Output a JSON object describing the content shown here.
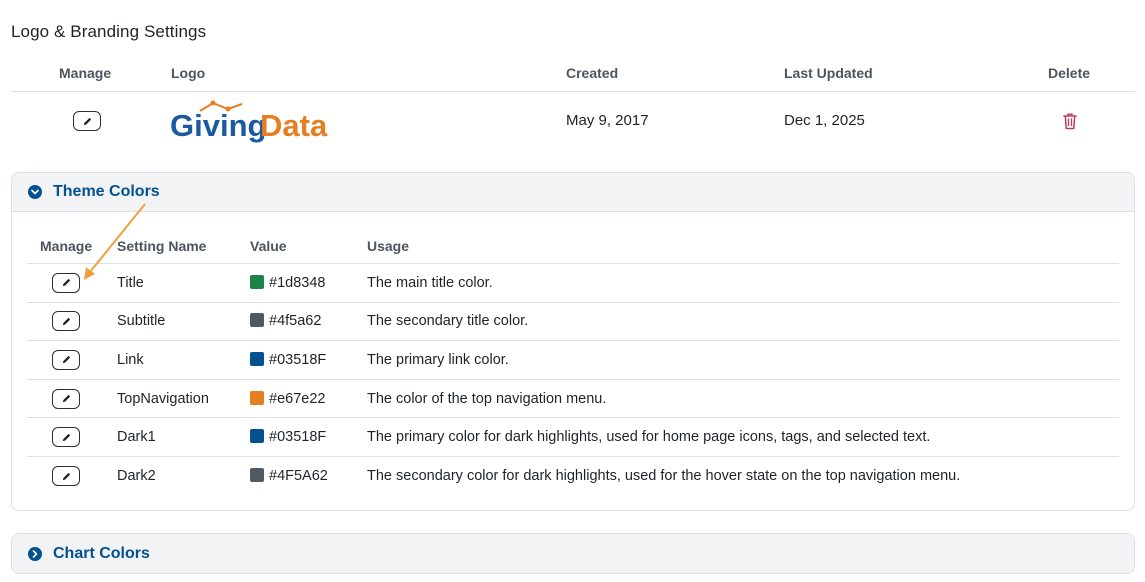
{
  "page": {
    "title": "Logo & Branding Settings"
  },
  "logo_table": {
    "headers": {
      "manage": "Manage",
      "logo": "Logo",
      "created": "Created",
      "updated": "Last Updated",
      "delete": "Delete"
    },
    "row": {
      "logo_text_part1": "Giving",
      "logo_text_part2": "Data",
      "created": "May 9, 2017",
      "updated": "Dec 1, 2025"
    }
  },
  "theme_colors": {
    "title": "Theme Colors",
    "headers": {
      "manage": "Manage",
      "name": "Setting Name",
      "value": "Value",
      "usage": "Usage"
    },
    "rows": [
      {
        "name": "Title",
        "value": "#1d8348",
        "usage": "The main title color."
      },
      {
        "name": "Subtitle",
        "value": "#4f5a62",
        "usage": "The secondary title color."
      },
      {
        "name": "Link",
        "value": "#03518F",
        "usage": "The primary link color."
      },
      {
        "name": "TopNavigation",
        "value": "#e67e22",
        "usage": "The color of the top navigation menu."
      },
      {
        "name": "Dark1",
        "value": "#03518F",
        "usage": "The primary color for dark highlights, used for home page icons, tags, and selected text."
      },
      {
        "name": "Dark2",
        "value": "#4F5A62",
        "usage": "The secondary color for dark highlights, used for the hover state on the top navigation menu."
      }
    ]
  },
  "chart_colors": {
    "title": "Chart Colors"
  },
  "colors": {
    "accent": "#03518F",
    "logo_blue": "#1a5aa3",
    "logo_orange": "#e67e22",
    "delete_red": "#c0395e",
    "annotation_arrow": "#f0a040"
  },
  "icons": {
    "edit": "pencil-icon",
    "delete": "trash-icon",
    "expanded": "chevron-down-icon",
    "collapsed": "chevron-right-icon"
  }
}
